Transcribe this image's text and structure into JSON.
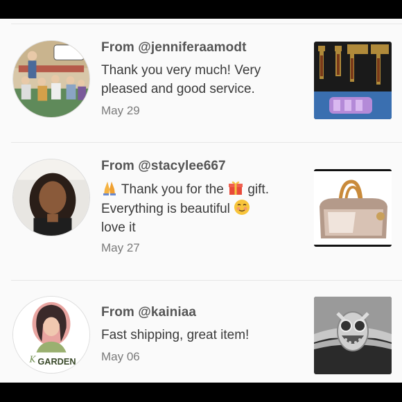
{
  "reviews": [
    {
      "from": "From @jenniferaamodt",
      "message": "Thank you very much! Very pleased and good service.",
      "date": "May 29",
      "avatar_icon": "cartoon-avatar",
      "thumb_icon": "jewelry-earrings-thumbnail"
    },
    {
      "from": "From @stacylee667",
      "message_parts": {
        "part1": " Thank you for the ",
        "part2": " gift.",
        "part3": "Everything is beautiful ",
        "part4": "love it"
      },
      "date": "May 27",
      "avatar_icon": "woman-avatar",
      "thumb_icon": "metallic-handbag-thumbnail"
    },
    {
      "from": "From @kainiaa",
      "message": "Fast shipping, great item!",
      "date": "May 06",
      "avatar_icon": "garden-logo-avatar",
      "avatar_text": "GARDEN",
      "thumb_icon": "owl-bracelet-thumbnail"
    }
  ],
  "colors": {
    "background": "#fafafa",
    "divider": "#e6e6e6",
    "username": "#555555",
    "message": "#3a3a3a",
    "date": "#7a7a7a"
  }
}
